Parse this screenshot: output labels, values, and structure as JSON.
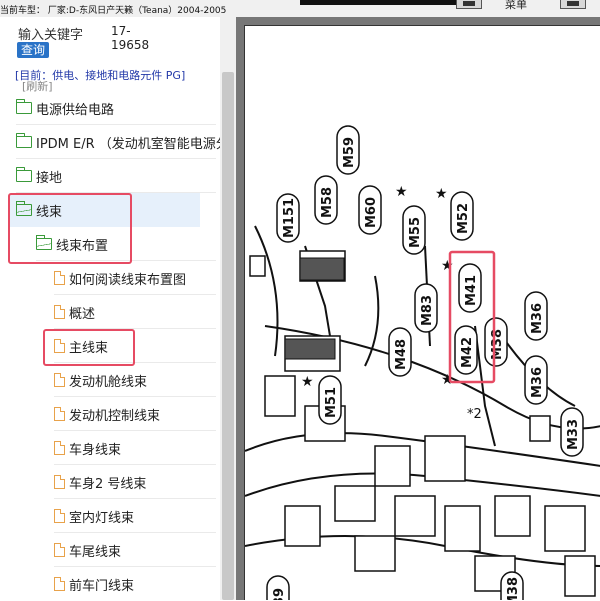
{
  "topbar": {
    "vehicle_text": "当前车型： 厂家:D-东风日产天籁（Teana）2004-2005",
    "menu_label": "菜单"
  },
  "search": {
    "label": "输入关键字",
    "value": "17-19658",
    "button": "查询"
  },
  "current": {
    "text": "[目前：供电、接地和电路元件 PG]",
    "refresh": "[刷新]"
  },
  "tree": {
    "items": [
      {
        "label": "电源供给电路"
      },
      {
        "label": "IPDM E/R （发动机室智能电源分"
      },
      {
        "label": "接地"
      },
      {
        "label": "线束"
      },
      {
        "label": "线束布置"
      },
      {
        "label": "如何阅读线束布置图"
      },
      {
        "label": "概述"
      },
      {
        "label": "主线束"
      },
      {
        "label": "发动机舱线束"
      },
      {
        "label": "发动机控制线束"
      },
      {
        "label": "车身线束"
      },
      {
        "label": "车身2 号线束"
      },
      {
        "label": "室内灯线束"
      },
      {
        "label": "车尾线束"
      },
      {
        "label": "前车门线束"
      }
    ]
  },
  "diagram": {
    "connectors": [
      "M151",
      "M58",
      "M59",
      "M60",
      "M55",
      "M52",
      "M41",
      "M83",
      "M42",
      "M48",
      "M38",
      "M36",
      "M36",
      "M51",
      "M33",
      "M38",
      "39"
    ],
    "note": "*2",
    "highlight_color": "#e64b63"
  }
}
